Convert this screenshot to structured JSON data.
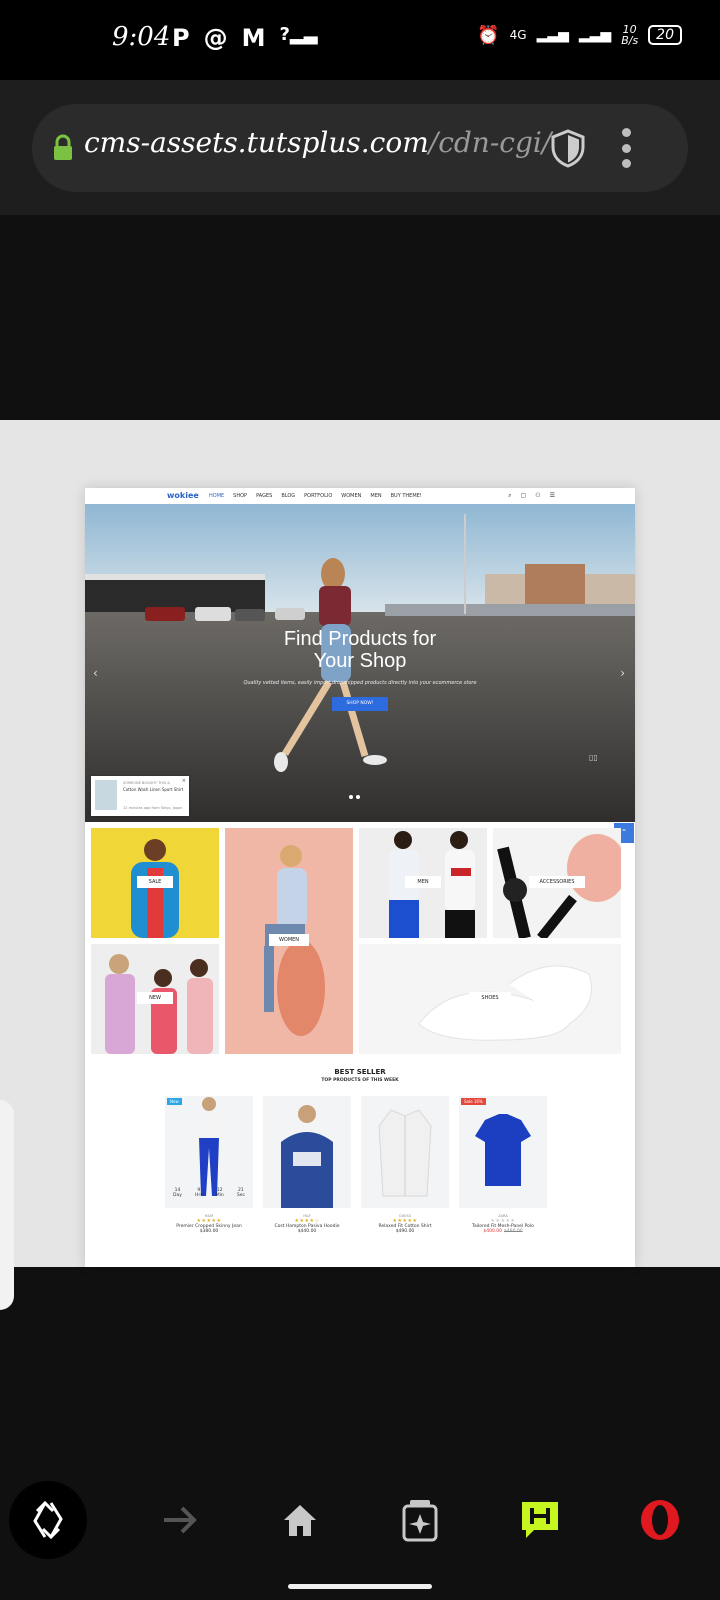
{
  "status_bar": {
    "time": "9:04",
    "left_icons": [
      "p-icon",
      "swirl-app-icon",
      "gmail-icon",
      "no-signal-icon"
    ],
    "alarm_icon": "alarm-icon",
    "network_label": "4G",
    "speed_value": "10",
    "speed_unit": "B/s",
    "battery": "20"
  },
  "browser": {
    "url_main": "cms-assets.tutsplus.com",
    "url_rest": "/cdn-cgi/imag",
    "lock_icon": "lock-icon",
    "shield_icon": "shield-icon",
    "menu_icon": "more-vert-icon"
  },
  "website": {
    "brand": "wokiee",
    "nav": [
      "HOME",
      "SHOP",
      "PAGES",
      "BLOG",
      "PORTFOLIO",
      "WOMEN",
      "MEN",
      "BUY THEME!"
    ],
    "nav_icons": [
      "search-icon",
      "bag-icon",
      "user-icon",
      "settings-icon"
    ],
    "hero": {
      "title_line1": "Find Products for",
      "title_line2": "Your Shop",
      "subtitle": "Quality vetted items, easily import dropshipped products directly into your ecommerce store",
      "button": "SHOP NOW!"
    },
    "notification": {
      "line1": "SOMEONE BOUGHT THIS &",
      "line2": "Cotton Wash Linen Sport Shirt",
      "line3": "12 minutes ago from Tokyo, Japan"
    },
    "categories": [
      "SALE",
      "WOMEN",
      "MEN",
      "ACCESSORIES",
      "NEW",
      "SHOES"
    ],
    "best_seller": {
      "title": "BEST SELLER",
      "subtitle": "TOP PRODUCTS OF THIS WEEK"
    },
    "countdown": [
      {
        "value": "14",
        "unit": "Day"
      },
      {
        "value": "9",
        "unit": "Hrs"
      },
      {
        "value": "12",
        "unit": "Min"
      },
      {
        "value": "21",
        "unit": "Sec"
      }
    ],
    "products": [
      {
        "badge": "New",
        "badge_color": "#2aa7e8",
        "brand": "H&M",
        "name": "Premier Cropped Skinny Jean",
        "price": "$380.00",
        "old_price": ""
      },
      {
        "badge": "",
        "badge_color": "",
        "brand": "H&F",
        "name": "Cost Hampton Pasiva Hoodie",
        "price": "$440.00",
        "old_price": ""
      },
      {
        "badge": "",
        "badge_color": "",
        "brand": "GUESS",
        "name": "Relaxed Fit Cotton Shirt",
        "price": "$490.00",
        "old_price": ""
      },
      {
        "badge": "Sale 16%",
        "badge_color": "#e5483c",
        "brand": "ZARA",
        "name": "Tailored Fit Mesh-Panel Polo",
        "price": "$400.00",
        "old_price": "$480.00"
      }
    ]
  },
  "bottom_nav": [
    "tab-switch-icon",
    "forward-icon",
    "home-icon",
    "speed-dial-icon",
    "chat-icon",
    "opera-icon"
  ]
}
